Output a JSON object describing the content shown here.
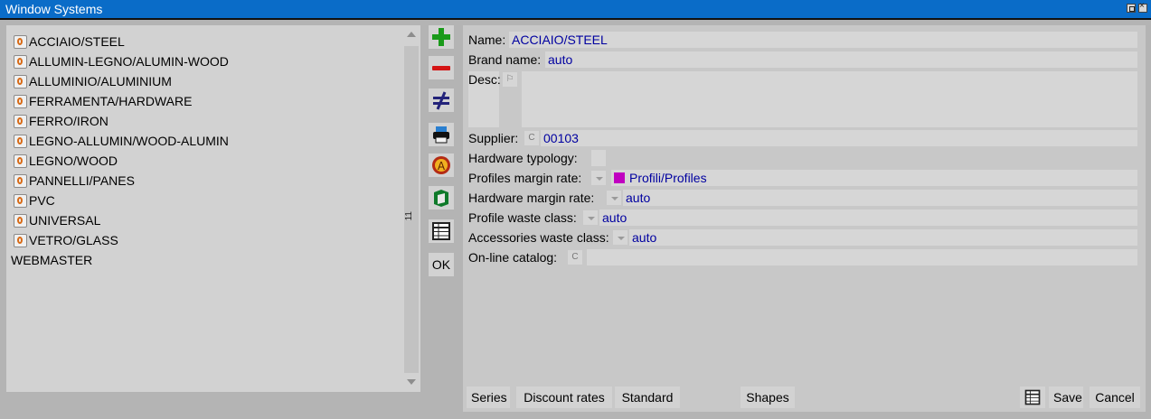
{
  "window": {
    "title": "Window Systems"
  },
  "list": {
    "items": [
      {
        "label": "ACCIAIO/STEEL",
        "has_icon": true
      },
      {
        "label": "ALLUMIN-LEGNO/ALUMIN-WOOD",
        "has_icon": true
      },
      {
        "label": "ALLUMINIO/ALUMINIUM",
        "has_icon": true
      },
      {
        "label": "FERRAMENTA/HARDWARE",
        "has_icon": true
      },
      {
        "label": "FERRO/IRON",
        "has_icon": true
      },
      {
        "label": "LEGNO-ALLUMIN/WOOD-ALUMIN",
        "has_icon": true
      },
      {
        "label": "LEGNO/WOOD",
        "has_icon": true
      },
      {
        "label": "PANNELLI/PANES",
        "has_icon": true
      },
      {
        "label": "PVC",
        "has_icon": true
      },
      {
        "label": "UNIVERSAL",
        "has_icon": true
      },
      {
        "label": "VETRO/GLASS",
        "has_icon": true
      },
      {
        "label": "WEBMASTER",
        "has_icon": false
      }
    ],
    "count": "11"
  },
  "toolbar": {
    "buttons": [
      "add-icon",
      "remove-icon",
      "not-equal-icon",
      "print-icon",
      "warning-icon",
      "package-icon",
      "table-icon"
    ],
    "ok_label": "OK"
  },
  "form": {
    "name_label": "Name:",
    "name_value": "ACCIAIO/STEEL",
    "brand_label": "Brand name:",
    "brand_value": "auto",
    "desc_label": "Desc:",
    "desc_value": "",
    "supplier_label": "Supplier:",
    "supplier_value": "00103",
    "hardware_typology_label": "Hardware typology:",
    "hardware_typology_value": "",
    "profiles_margin_label": "Profiles margin rate:",
    "profiles_margin_value": "Profili/Profiles",
    "profiles_margin_color": "#c000c0",
    "hardware_margin_label": "Hardware margin rate:",
    "hardware_margin_value": "auto",
    "profile_waste_label": "Profile waste class:",
    "profile_waste_value": "auto",
    "accessories_waste_label": "Accessories waste class:",
    "accessories_waste_value": "auto",
    "online_catalog_label": "On-line catalog:",
    "online_catalog_value": ""
  },
  "bottom": {
    "series_label": "Series",
    "discount_label": "Discount rates",
    "standard_label": "Standard",
    "shapes_label": "Shapes",
    "save_label": "Save",
    "cancel_label": "Cancel"
  }
}
